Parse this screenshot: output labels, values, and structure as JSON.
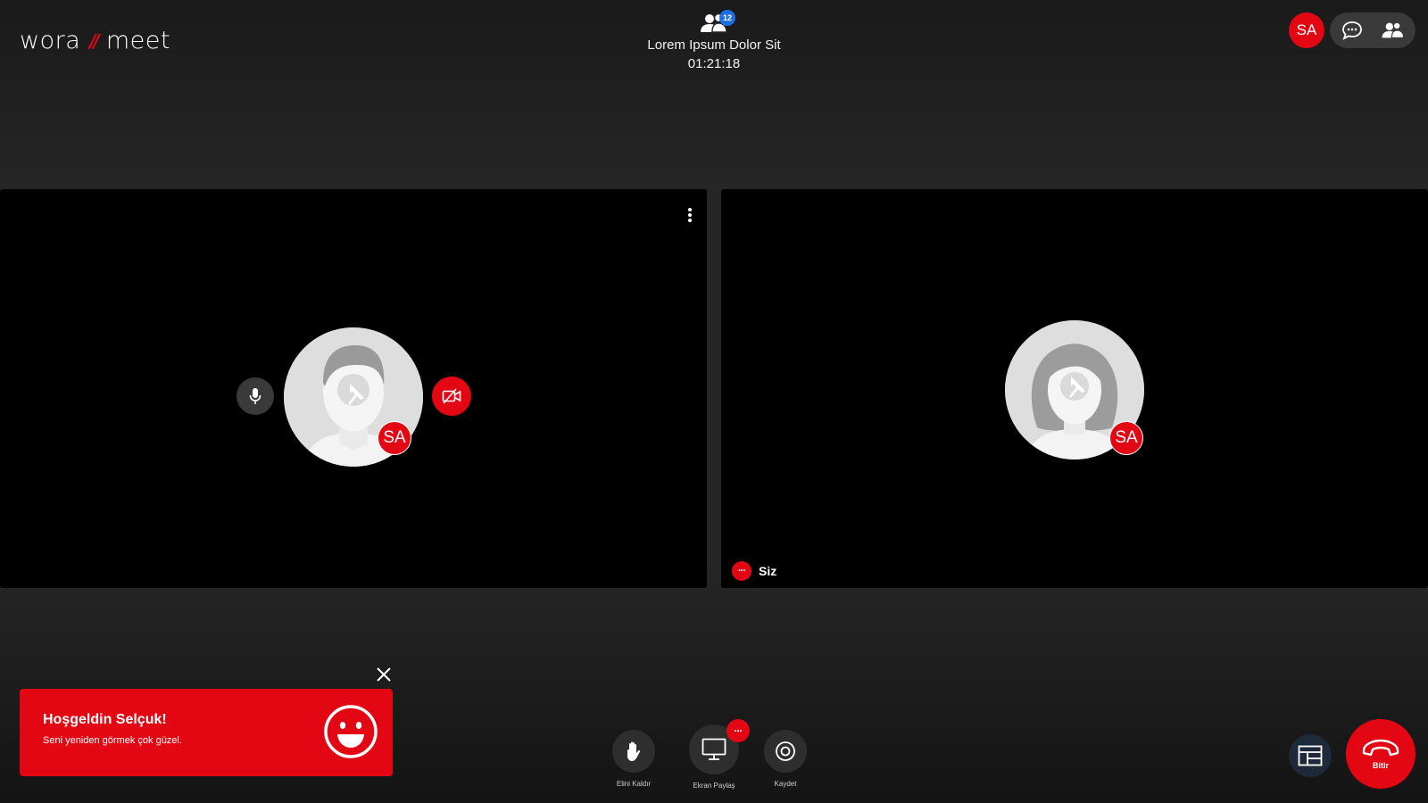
{
  "app": {
    "logo_left": "wora",
    "logo_slash": "//",
    "logo_right": "meet"
  },
  "meeting": {
    "title": "Lorem Ipsum Dolor Sit",
    "elapsed": "01:21:18",
    "participant_count": "12"
  },
  "header": {
    "user_initials": "SA",
    "chat_icon": "chat-bubble-icon",
    "participants_icon": "people-icon"
  },
  "tiles": [
    {
      "initials": "SA",
      "avatar_icon": "male-avatar-icon",
      "pin_icon": "pin-icon",
      "mic_icon": "microphone-icon",
      "camera_icon": "camera-off-icon",
      "menu_icon": "more-vertical-icon"
    },
    {
      "initials": "SA",
      "avatar_icon": "female-avatar-icon",
      "pin_icon": "pin-icon",
      "self_dots": "···",
      "self_label": "Siz"
    }
  ],
  "toast": {
    "title": "Hoşgeldin Selçuk!",
    "message": "Seni yeniden görmek çok güzel.",
    "emoji_icon": "smiley-icon",
    "close_icon": "close-icon"
  },
  "controls": {
    "raise_hand_label": "Elini Kaldır",
    "share_screen_label": "Ekran Paylaş",
    "share_badge": "···",
    "record_label": "Kaydet",
    "end_label": "Bitir"
  },
  "colors": {
    "accent": "#e30613",
    "badge_blue": "#1e6fe0",
    "tile_bg": "#000000"
  }
}
